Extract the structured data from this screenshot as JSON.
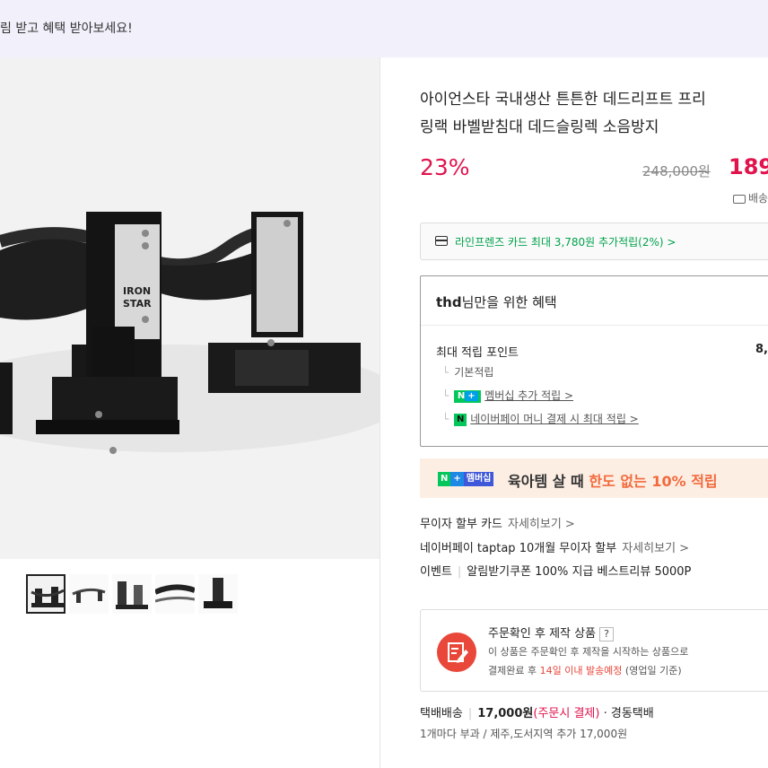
{
  "banner": {
    "text": "림 받고 혜택 받아보세요!"
  },
  "image": {
    "brand_text_1": "IRON",
    "brand_text_2": "STAR"
  },
  "product": {
    "title_line1": "아이언스타 국내생산 튼튼한 데드리프트 프리",
    "title_line2": "링랙 바벨받침대 데드슬링렉 소음방지",
    "discount": "23%",
    "original_price": "248,000원",
    "sale_price": "189",
    "delivery_partial": "배송"
  },
  "card_benefit": {
    "text": "라인프렌즈 카드 최대 3,780원 추가적립(2%) >"
  },
  "benefit": {
    "user": "thd",
    "title_suffix": "님만을 위한 혜택",
    "points_label": "최대 적립 포인트",
    "points_value": "8,",
    "rows": [
      {
        "label": "기본적립"
      },
      {
        "badge": "N+",
        "label": "멤버십 추가 적립 >"
      },
      {
        "badge": "N",
        "label": "네이버페이 머니 결제 시 최대 적립 >"
      }
    ]
  },
  "promo": {
    "badge_n": "N",
    "badge_plus": "+",
    "badge_membership": "멤버십",
    "text_1": "육아템 살 때 ",
    "text_highlight": "한도 없는 10% 적립"
  },
  "info": {
    "installment_label": "무이자 할부 카드",
    "installment_more": "자세히보기 >",
    "taptap_label": "네이버페이 taptap 10개월 무이자 할부",
    "taptap_more": "자세히보기 >",
    "event_label": "이벤트",
    "event_text": "알림받기쿠폰 100% 지급 베스트리뷰 5000P"
  },
  "custom_order": {
    "title": "주문확인 후 제작 상품",
    "q": "?",
    "desc_line1": "이 상품은 주문확인 후 제작을 시작하는 상품으로",
    "desc_prefix": "결제완료 후 ",
    "desc_highlight": "14일 이내 발송예정",
    "desc_suffix": " (영업일 기준)"
  },
  "shipping": {
    "method": "택배배송",
    "fee": "17,000원",
    "fee_note": "(주문시 결제)",
    "carrier": "· 경동택배",
    "note": "1개마다 부과 / 제주,도서지역 추가 17,000원"
  },
  "colors": {
    "accent_red": "#e0134d",
    "naver_green": "#03c75a",
    "promo_orange": "#f26a3c"
  }
}
